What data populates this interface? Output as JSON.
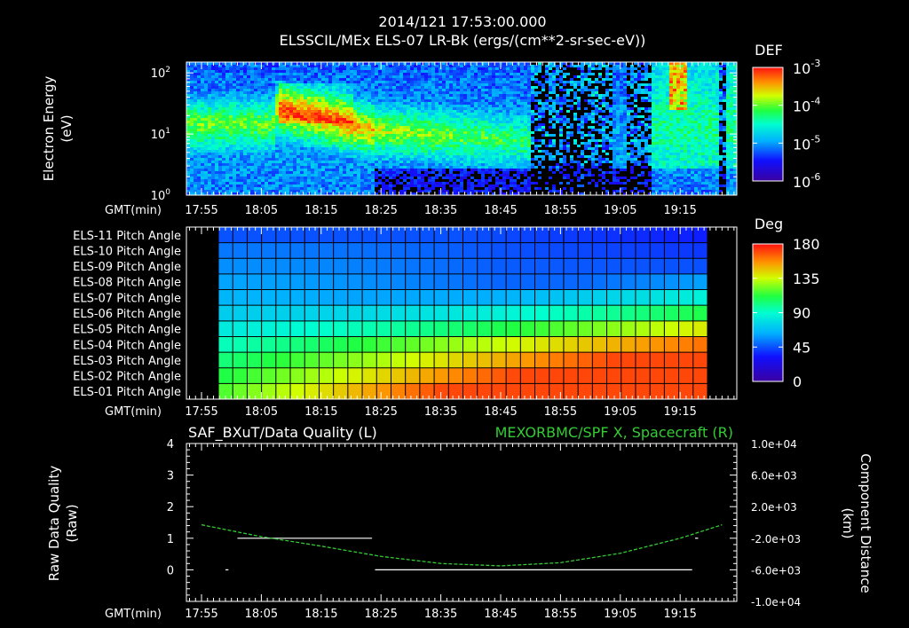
{
  "header": {
    "timestamp": "2014/121 17:53:00.000",
    "subtitle": "ELSSCIL/MEx ELS-07 LR-Bk  (ergs/(cm**2-sr-sec-eV))"
  },
  "time_ticks": [
    "17:55",
    "18:05",
    "18:15",
    "18:25",
    "18:35",
    "18:45",
    "18:55",
    "19:05",
    "19:15"
  ],
  "gmt_label": "GMT(min)",
  "chart_data": [
    {
      "type": "heatmap",
      "title": "ELSSCIL/MEx ELS-07 LR-Bk  (ergs/(cm**2-sr-sec-eV))",
      "ylabel_line1": "Electron Energy",
      "ylabel_line2": "(eV)",
      "y_scale": "log",
      "ylim": [
        1,
        150
      ],
      "y_ticks": [
        {
          "base": "10",
          "exp": "0"
        },
        {
          "base": "10",
          "exp": "1"
        },
        {
          "base": "10",
          "exp": "2"
        }
      ],
      "colorbar": {
        "label": "DEF",
        "scale": "log",
        "ticks": [
          {
            "base": "10",
            "exp": "-3"
          },
          {
            "base": "10",
            "exp": "-4"
          },
          {
            "base": "10",
            "exp": "-5"
          },
          {
            "base": "10",
            "exp": "-6"
          }
        ]
      },
      "x_ticks": [
        "17:55",
        "18:05",
        "18:15",
        "18:25",
        "18:35",
        "18:45",
        "18:55",
        "19:05",
        "19:15"
      ]
    },
    {
      "type": "heatmap",
      "rows": [
        "ELS-11 Pitch Angle",
        "ELS-10 Pitch Angle",
        "ELS-09 Pitch Angle",
        "ELS-08 Pitch Angle",
        "ELS-07 Pitch Angle",
        "ELS-06 Pitch Angle",
        "ELS-05 Pitch Angle",
        "ELS-04 Pitch Angle",
        "ELS-03 Pitch Angle",
        "ELS-02 Pitch Angle",
        "ELS-01 Pitch Angle"
      ],
      "colorbar": {
        "label": "Deg",
        "ticks": [
          "180",
          "135",
          "90",
          "45",
          "0"
        ],
        "range": [
          0,
          180
        ]
      },
      "x_ticks": [
        "17:55",
        "18:05",
        "18:15",
        "18:25",
        "18:35",
        "18:45",
        "18:55",
        "19:05",
        "19:15"
      ]
    },
    {
      "type": "line",
      "title_left": "SAF_BXuT/Data Quality (L)",
      "title_right": "MEXORBMC/SPF X, Spacecraft (R)",
      "ylabel_left_line1": "Raw Data Quality",
      "ylabel_left_line2": "(Raw)",
      "ylabel_right_line1": "Component Distance",
      "ylabel_right_line2": "(km)",
      "ylim_left": [
        -1,
        4
      ],
      "y_ticks_left": [
        "4",
        "3",
        "2",
        "1",
        "0"
      ],
      "ylim_right": [
        -10000,
        10000
      ],
      "y_ticks_right": [
        "1.0e+04",
        "6.0e+03",
        "2.0e+03",
        "-2.0e+03",
        "-6.0e+03",
        "-1.0e+04"
      ],
      "x_ticks": [
        "17:55",
        "18:05",
        "18:15",
        "18:25",
        "18:35",
        "18:45",
        "18:55",
        "19:05",
        "19:15"
      ],
      "series": [
        {
          "name": "SAF_BXuT/Data Quality",
          "color": "#ffffff",
          "segments": [
            {
              "x": [
                "17:59",
                "17:59.5"
              ],
              "y": [
                0,
                0
              ]
            },
            {
              "x": [
                "18:01",
                "18:23.5"
              ],
              "y": [
                1,
                1
              ]
            },
            {
              "x": [
                "18:24",
                "19:17"
              ],
              "y": [
                0,
                0
              ]
            },
            {
              "x": [
                "19:17.5",
                "19:18"
              ],
              "y": [
                1,
                1
              ]
            }
          ]
        },
        {
          "name": "MEXORBMC/SPF X, Spacecraft",
          "color": "#33cc33",
          "x": [
            "17:55",
            "18:05",
            "18:15",
            "18:25",
            "18:35",
            "18:45",
            "18:55",
            "19:05",
            "19:15",
            "19:22"
          ],
          "y": [
            -300,
            -1800,
            -3000,
            -4300,
            -5200,
            -5500,
            -5100,
            -3900,
            -2000,
            -300
          ]
        }
      ]
    }
  ]
}
